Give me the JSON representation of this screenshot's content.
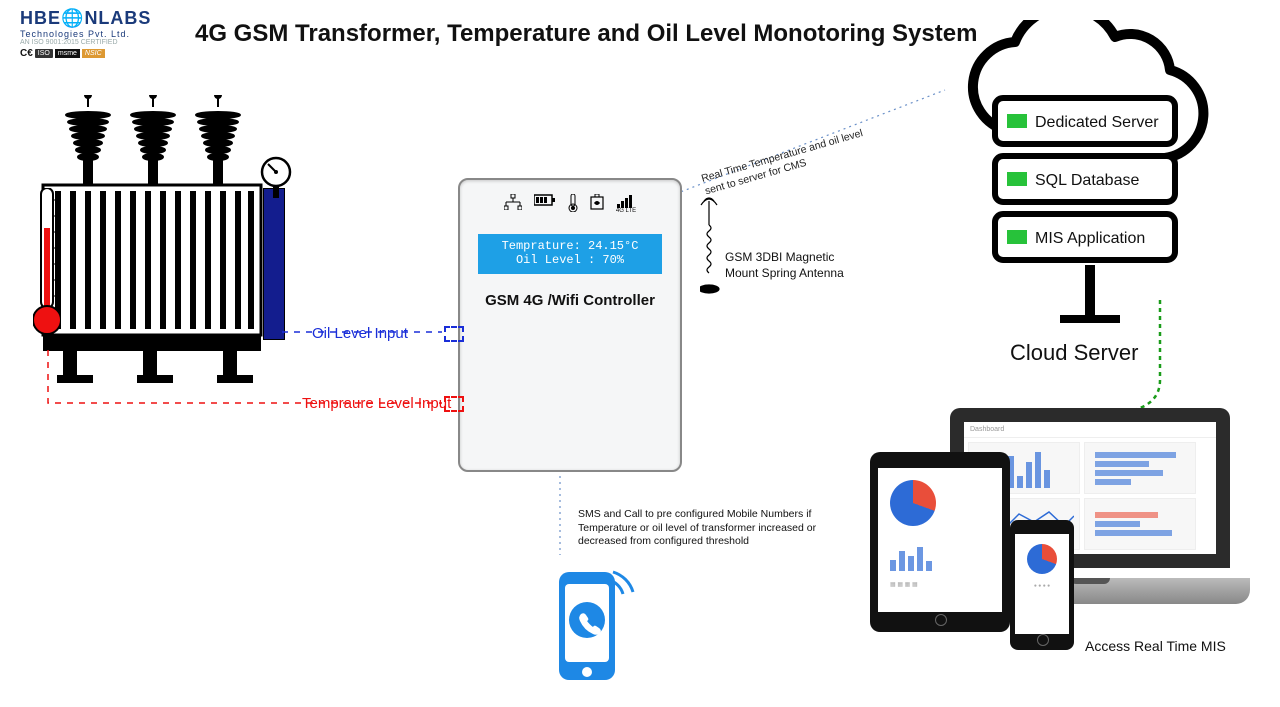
{
  "logo": {
    "line1a": "HBE",
    "line1b": "NLABS",
    "line2": "Technologies Pvt. Ltd.",
    "line3": "AN ISO 9001:2015 CERTIFIED",
    "certs": {
      "ce": "C€",
      "iso": "ISO",
      "msme": "msme",
      "nsic": "NSIC"
    }
  },
  "title": "4G GSM Transformer, Temperature  and Oil Level Monotoring System",
  "inputs": {
    "oil": "Oil Level Input",
    "temp": "Tempraure Level Input"
  },
  "controller": {
    "lcd_line1": "Temprature: 24.15°C",
    "lcd_line2": "Oil Level : 70%",
    "title": "GSM 4G /Wifi Controller",
    "lte_label": "4G LTE",
    "icons": [
      "network-icon",
      "battery-icon",
      "thermometer-icon",
      "oil-level-icon",
      "signal-lte-icon"
    ]
  },
  "antenna": {
    "label": "GSM 3DBI Magnetic Mount Spring Antenna"
  },
  "upload": {
    "note": "Real Time Temperature and oil level sent to server for CMS"
  },
  "cloud": {
    "servers": [
      "Dedicated Server",
      "SQL Database",
      "MIS Application"
    ],
    "label": "Cloud Server"
  },
  "sms": {
    "note": "SMS and Call to pre configured Mobile Numbers if Temperature or oil level of transformer increased or decreased  from configured threshold"
  },
  "mis": {
    "label": "Access Real Time MIS"
  },
  "colors": {
    "blue": "#1a2ed8",
    "red": "#e11",
    "green_led": "#27c23a",
    "lcd_bg": "#1ea0e6",
    "phone_icon": "#1e88e5",
    "pie_red": "#e94e3a",
    "pie_blue": "#2d6bd6"
  }
}
